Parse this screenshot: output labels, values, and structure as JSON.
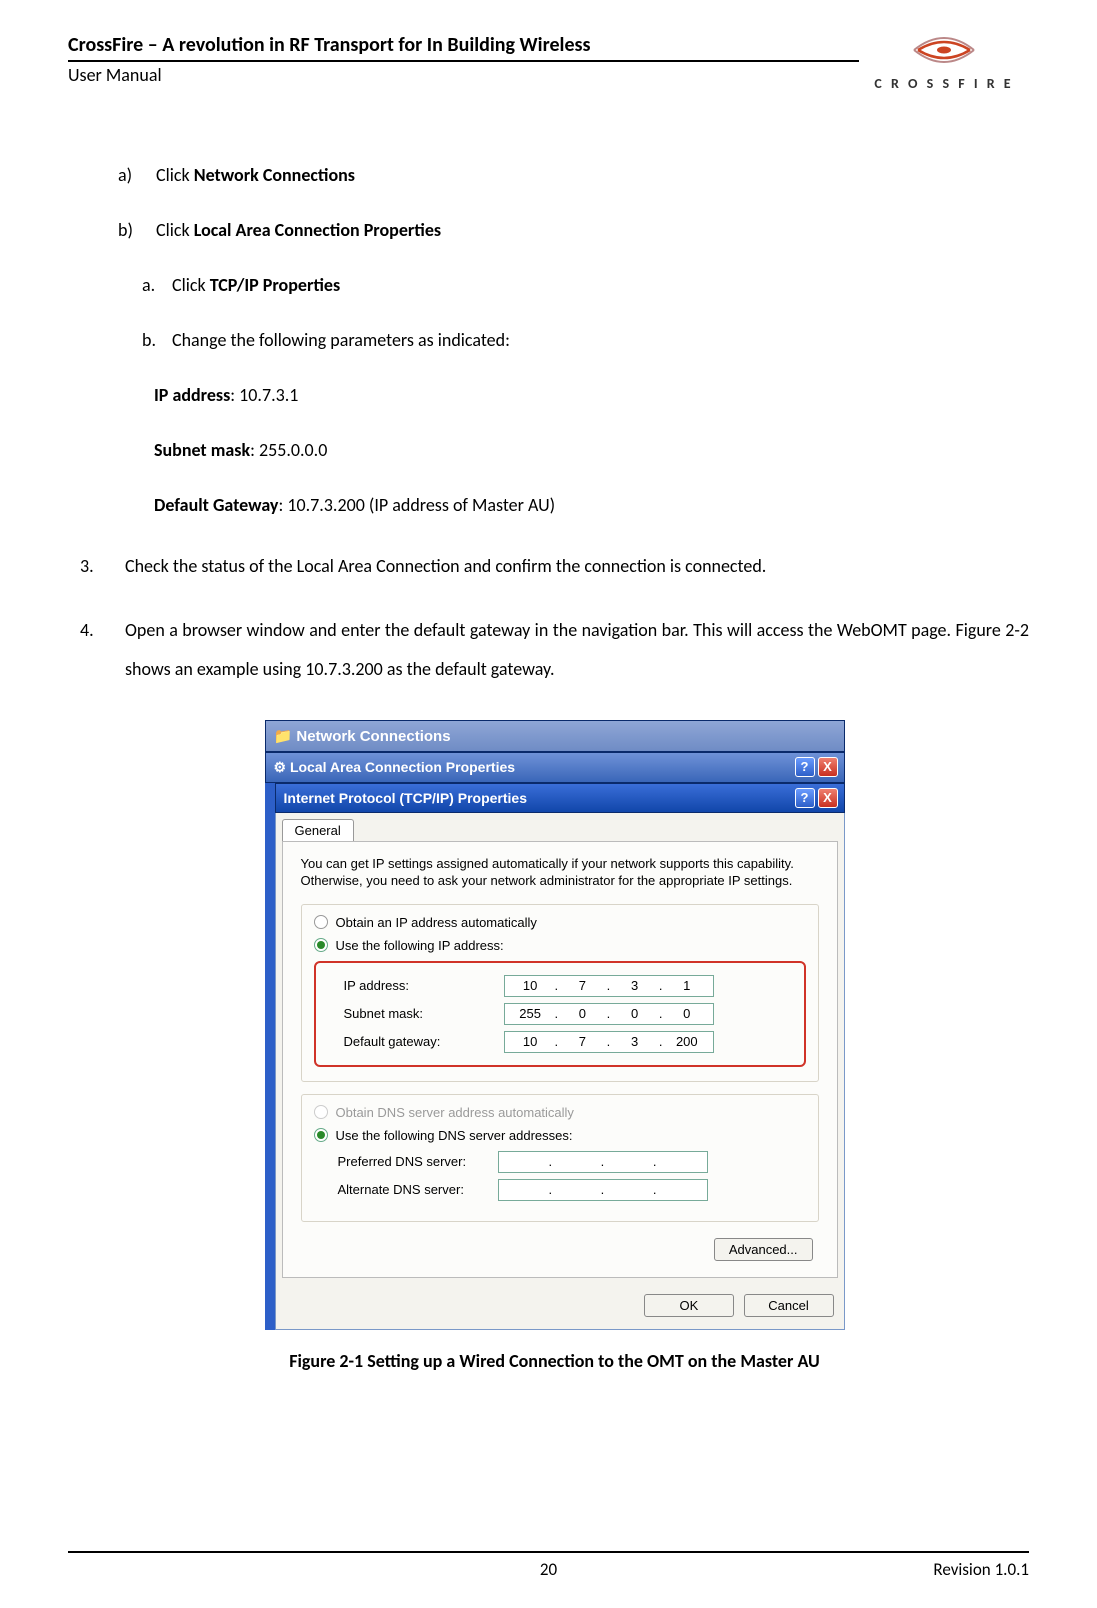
{
  "header": {
    "title": "CrossFire – A revolution in RF Transport for In Building Wireless",
    "subtitle": "User Manual",
    "brand": "C R O S S F I R E"
  },
  "steps": {
    "a_marker": "a)",
    "a_prefix": "Click ",
    "a_bold": "Network Connections",
    "b_marker": "b)",
    "b_prefix": "Click ",
    "b_bold": "Local Area Connection Properties",
    "ba_marker": "a.",
    "ba_prefix": "Click ",
    "ba_bold": "TCP/IP Properties",
    "bb_marker": "b.",
    "bb_text": "Change the following parameters as indicated:",
    "ip_label": "IP address",
    "ip_value": ": 10.7.3.1",
    "mask_label": "Subnet mask",
    "mask_value": ": 255.0.0.0",
    "gw_label": "Default Gateway",
    "gw_value": ": 10.7.3.200 (IP address of Master AU)",
    "n3_marker": "3.",
    "n3_text": "Check the status of the Local Area Connection and confirm the connection is connected.",
    "n4_marker": "4.",
    "n4_text": "Open a browser window and enter the default gateway in the navigation bar. This will access the WebOMT page. Figure 2-2 shows an example using 10.7.3.200 as the default gateway."
  },
  "dialog": {
    "win1_title": "Network Connections",
    "win2_title": "Local Area Connection Properties",
    "win3_title": "Internet Protocol (TCP/IP) Properties",
    "help_btn": "?",
    "close_btn": "X",
    "tab_general": "General",
    "intro": "You can get IP settings assigned automatically if your network supports this capability. Otherwise, you need to ask your network administrator for the appropriate IP settings.",
    "radio_auto_ip": "Obtain an IP address automatically",
    "radio_use_ip": "Use the following IP address:",
    "lbl_ip": "IP address:",
    "lbl_mask": "Subnet mask:",
    "lbl_gw": "Default gateway:",
    "ip": {
      "o1": "10",
      "o2": "7",
      "o3": "3",
      "o4": "1"
    },
    "mask": {
      "o1": "255",
      "o2": "0",
      "o3": "0",
      "o4": "0"
    },
    "gw": {
      "o1": "10",
      "o2": "7",
      "o3": "3",
      "o4": "200"
    },
    "radio_auto_dns": "Obtain DNS server address automatically",
    "radio_use_dns": "Use the following DNS server addresses:",
    "lbl_pref_dns": "Preferred DNS server:",
    "lbl_alt_dns": "Alternate DNS server:",
    "btn_advanced": "Advanced...",
    "btn_ok": "OK",
    "btn_cancel": "Cancel"
  },
  "figure_caption": "Figure 2-1 Setting up a Wired Connection to the OMT on the Master AU",
  "footer": {
    "page": "20",
    "revision": "Revision 1.0.1"
  }
}
